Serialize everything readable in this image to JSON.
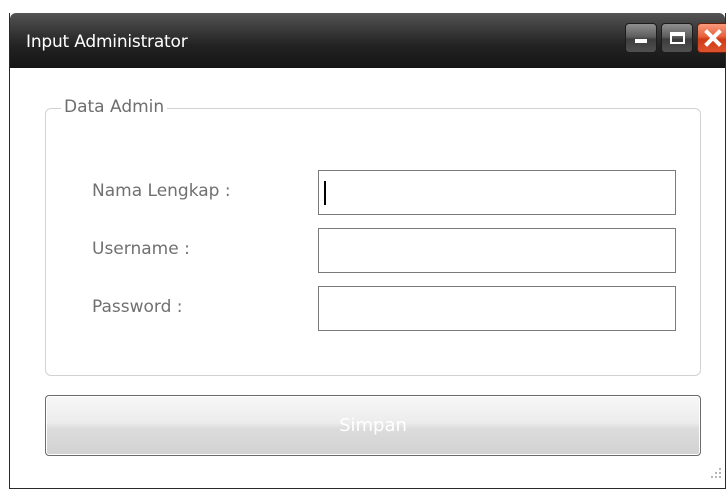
{
  "window": {
    "title": "Input Administrator",
    "controls": {
      "minimize": "minimize-icon",
      "maximize": "maximize-icon",
      "close": "close-icon"
    }
  },
  "group": {
    "title": "Data Admin",
    "fields": [
      {
        "label": "Nama Lengkap :",
        "value": "",
        "focused": true
      },
      {
        "label": "Username :",
        "value": ""
      },
      {
        "label": "Password :",
        "value": ""
      }
    ]
  },
  "actions": {
    "save_label": "Simpan"
  },
  "colors": {
    "titlebar": "#222222",
    "close_button": "#e6603a",
    "label_text": "#707070"
  }
}
